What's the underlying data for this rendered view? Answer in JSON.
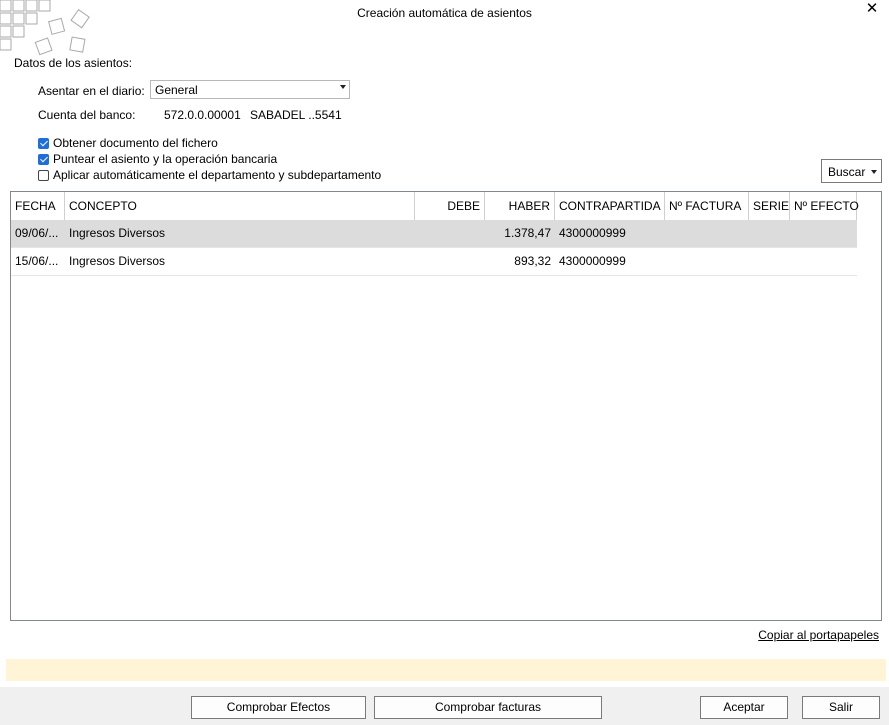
{
  "window": {
    "title": "Creación automática de asientos",
    "close_glyph": "✕"
  },
  "section": {
    "label": "Datos de los asientos:"
  },
  "diario": {
    "label": "Asentar en el diario:",
    "value": "General"
  },
  "banco": {
    "label": "Cuenta del banco:",
    "account": "572.0.0.00001",
    "name": "SABADEL ..5541"
  },
  "options": [
    {
      "label": "Obtener documento del fichero",
      "checked": true
    },
    {
      "label": "Puntear el asiento y la operación bancaria",
      "checked": true
    },
    {
      "label": "Aplicar automáticamente el departamento y subdepartamento",
      "checked": false
    }
  ],
  "search": {
    "label": "Buscar"
  },
  "table": {
    "columns": [
      "FECHA",
      "CONCEPTO",
      "DEBE",
      "HABER",
      "CONTRAPARTIDA",
      "Nº FACTURA",
      "SERIE",
      "Nº EFECTO"
    ],
    "rows": [
      {
        "fecha": "09/06/...",
        "concepto": "Ingresos Diversos",
        "debe": "",
        "haber": "1.378,47",
        "contrapartida": "4300000999",
        "factura": "",
        "serie": "",
        "efecto": "",
        "selected": true
      },
      {
        "fecha": "15/06/...",
        "concepto": "Ingresos Diversos",
        "debe": "",
        "haber": "893,32",
        "contrapartida": "4300000999",
        "factura": "",
        "serie": "",
        "efecto": "",
        "selected": false
      }
    ]
  },
  "copy_link": "Copiar al portapapeles",
  "buttons": {
    "comprobar_efectos": "Comprobar Efectos",
    "comprobar_facturas": "Comprobar facturas",
    "aceptar": "Aceptar",
    "salir": "Salir"
  },
  "colors": {
    "checkbox_checked": "#1e6fd9",
    "selected_row": "#dcdcdc",
    "info_bar": "#fff4d6",
    "footer": "#f0f0f0"
  }
}
